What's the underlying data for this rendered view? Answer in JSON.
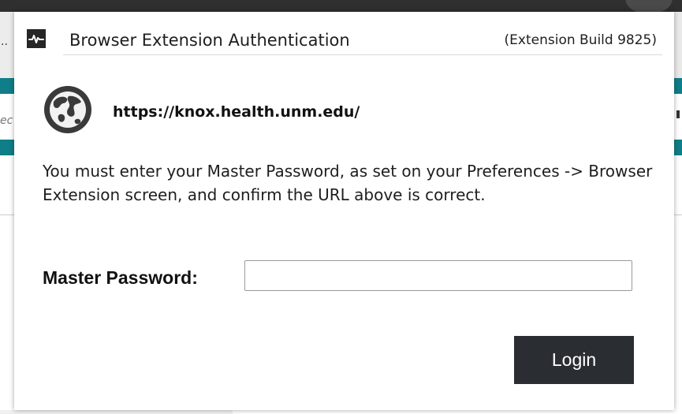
{
  "background": {
    "left_ellipsis": "..",
    "left_text_fragment": "ec"
  },
  "dialog": {
    "app_icon": "heartbeat-icon",
    "title": "Browser Extension Authentication",
    "build": "(Extension Build 9825)",
    "site_icon": "globe-icon",
    "url": "https://knox.health.unm.edu/",
    "message": "You must enter your Master Password, as set on your Preferences -> Browser Extension screen, and confirm the URL above is correct.",
    "password_label": "Master Password:",
    "password_value": "",
    "login_label": "Login"
  },
  "colors": {
    "accent_teal": "#0f7e88",
    "button_bg": "#2a2e33",
    "topbar": "#2f2f2f"
  }
}
